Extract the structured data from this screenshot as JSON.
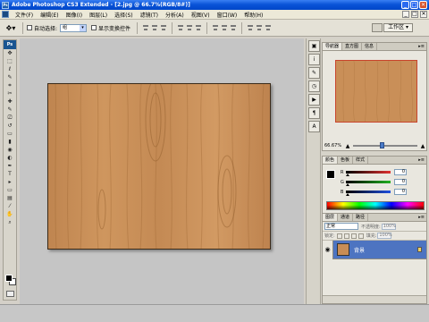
{
  "title_bar": {
    "app_icon": "Ps",
    "title": "Adobe Photoshop CS3 Extended - [2.jpg @ 66.7%(RGB/8#)]",
    "controls": [
      "minimize",
      "maximize",
      "close"
    ],
    "control_glyphs": {
      "minimize": "_",
      "maximize": "□",
      "close": "✕"
    }
  },
  "menu_bar": {
    "items": [
      "文件(F)",
      "编辑(E)",
      "图像(I)",
      "图层(L)",
      "选择(S)",
      "滤镜(T)",
      "分析(A)",
      "视图(V)",
      "窗口(W)",
      "帮助(H)"
    ],
    "doc_controls": {
      "minimize": "_",
      "restore": "□",
      "close": "✕"
    }
  },
  "options_bar": {
    "tool_preset_icon": "move-tool-icon",
    "tool_preset_glyph": "✥▾",
    "auto_select_label": "自动选择:",
    "auto_select_value": "组",
    "auto_select_checked": false,
    "show_transform_label": "显示变换控件",
    "show_transform_checked": false,
    "workspace_label": "工作区 ▾"
  },
  "toolbox": {
    "logo": "Ps",
    "tools": [
      "move",
      "marquee",
      "lasso",
      "quick-select",
      "crop",
      "slice",
      "healing",
      "brush",
      "clone",
      "history-brush",
      "eraser",
      "gradient",
      "blur",
      "dodge",
      "pen",
      "type",
      "path-select",
      "shape",
      "notes",
      "eyedropper",
      "hand",
      "zoom"
    ],
    "tool_glyphs": [
      "✥",
      "⬚",
      "ℓ",
      "✎",
      "⌗",
      "✂",
      "✚",
      "✎",
      "⎚",
      "↺",
      "▭",
      "▮",
      "◉",
      "◐",
      "✒",
      "T",
      "▸",
      "▭",
      "▤",
      "⁄",
      "✋",
      "⌕"
    ],
    "foreground_color": "#000000",
    "background_color": "#ffffff"
  },
  "document": {
    "content": "wood grain texture"
  },
  "dock_icons": [
    "navigator-icon",
    "info-icon",
    "brush-preset-icon",
    "history-icon",
    "actions-icon",
    "paragraph-icon",
    "character-icon"
  ],
  "dock_glyphs": [
    "▣",
    "i",
    "✎",
    "◷",
    "▶",
    "¶",
    "A"
  ],
  "navigator_panel": {
    "tabs": [
      "导航器",
      "直方图",
      "信息"
    ],
    "active_tab": 0,
    "zoom_value": "66.67%",
    "zoom_level_fraction": 0.42,
    "zoom_out_glyph": "▲",
    "zoom_in_glyph": "▲",
    "menu_glyph": "▸≡"
  },
  "color_panel": {
    "tabs": [
      "颜色",
      "色板",
      "样式"
    ],
    "active_tab": 0,
    "channels": [
      {
        "label": "R",
        "value": "0",
        "color": "#e03030"
      },
      {
        "label": "G",
        "value": "0",
        "color": "#20b020"
      },
      {
        "label": "B",
        "value": "0",
        "color": "#2050e0"
      }
    ],
    "menu_glyph": "▸≡"
  },
  "layers_panel": {
    "tabs": [
      "图层",
      "通道",
      "路径"
    ],
    "active_tab": 0,
    "blend_mode": "正常",
    "opacity_label": "不透明度:",
    "opacity_value": "100%",
    "lock_label": "锁定:",
    "fill_label": "填充:",
    "fill_value": "100%",
    "layers": [
      {
        "name": "背景",
        "visible": true,
        "locked": true,
        "eye_glyph": "◉"
      }
    ],
    "menu_glyph": "▸≡"
  }
}
